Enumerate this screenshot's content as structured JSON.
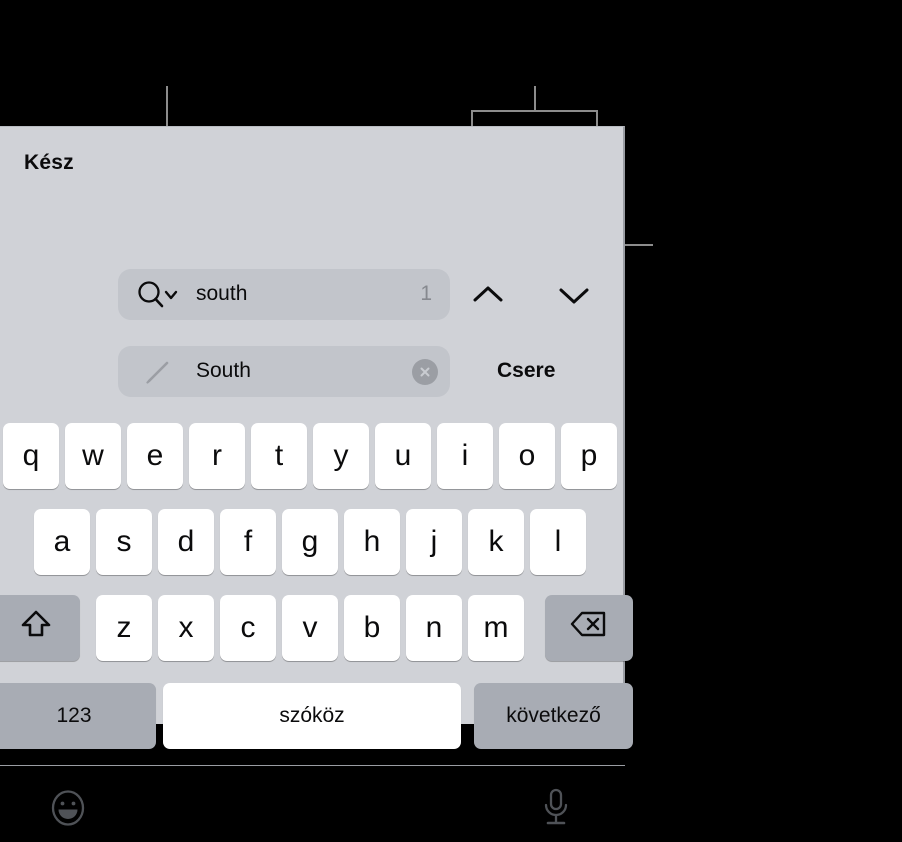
{
  "background_color": "#000000",
  "panel": {
    "background_color": "#d0d2d7",
    "key_color": "#ffffff",
    "special_key_color": "#a8acb4",
    "field_color": "#c2c5cb"
  },
  "find_bar": {
    "done_label": "Kész",
    "replace_label": "Csere",
    "find_field": {
      "icon": "search-icon",
      "dropdown_icon": "chevron-down-icon",
      "value": "south",
      "match_count": "1"
    },
    "replace_field": {
      "icon": "pencil-icon",
      "value": "South",
      "clear_icon": "close-circle-icon"
    },
    "nav": {
      "previous_icon": "chevron-up-icon",
      "next_icon": "chevron-down-icon"
    }
  },
  "keyboard": {
    "rows": [
      {
        "name": "row-1",
        "keys": [
          {
            "label": "q",
            "name": "key-q",
            "type": "letter"
          },
          {
            "label": "w",
            "name": "key-w",
            "type": "letter"
          },
          {
            "label": "e",
            "name": "key-e",
            "type": "letter"
          },
          {
            "label": "r",
            "name": "key-r",
            "type": "letter"
          },
          {
            "label": "t",
            "name": "key-t",
            "type": "letter"
          },
          {
            "label": "y",
            "name": "key-y",
            "type": "letter"
          },
          {
            "label": "u",
            "name": "key-u",
            "type": "letter"
          },
          {
            "label": "i",
            "name": "key-i",
            "type": "letter"
          },
          {
            "label": "o",
            "name": "key-o",
            "type": "letter"
          },
          {
            "label": "p",
            "name": "key-p",
            "type": "letter"
          }
        ]
      },
      {
        "name": "row-2",
        "keys": [
          {
            "label": "a",
            "name": "key-a",
            "type": "letter"
          },
          {
            "label": "s",
            "name": "key-s",
            "type": "letter"
          },
          {
            "label": "d",
            "name": "key-d",
            "type": "letter"
          },
          {
            "label": "f",
            "name": "key-f",
            "type": "letter"
          },
          {
            "label": "g",
            "name": "key-g",
            "type": "letter"
          },
          {
            "label": "h",
            "name": "key-h",
            "type": "letter"
          },
          {
            "label": "j",
            "name": "key-j",
            "type": "letter"
          },
          {
            "label": "k",
            "name": "key-k",
            "type": "letter"
          },
          {
            "label": "l",
            "name": "key-l",
            "type": "letter"
          }
        ]
      },
      {
        "name": "row-3",
        "keys": [
          {
            "label": "",
            "name": "key-shift",
            "type": "shift",
            "icon": "shift-arrow-icon"
          },
          {
            "label": "z",
            "name": "key-z",
            "type": "letter"
          },
          {
            "label": "x",
            "name": "key-x",
            "type": "letter"
          },
          {
            "label": "c",
            "name": "key-c",
            "type": "letter"
          },
          {
            "label": "v",
            "name": "key-v",
            "type": "letter"
          },
          {
            "label": "b",
            "name": "key-b",
            "type": "letter"
          },
          {
            "label": "n",
            "name": "key-n",
            "type": "letter"
          },
          {
            "label": "m",
            "name": "key-m",
            "type": "letter"
          },
          {
            "label": "",
            "name": "key-backspace",
            "type": "backspace",
            "icon": "delete-left-icon"
          }
        ]
      },
      {
        "name": "row-4",
        "keys": [
          {
            "label": "123",
            "name": "key-numbers",
            "type": "special"
          },
          {
            "label": "szóköz",
            "name": "key-space",
            "type": "space"
          },
          {
            "label": "következő",
            "name": "key-next",
            "type": "special"
          }
        ]
      }
    ],
    "utility": {
      "emoji_icon": "emoji-smiley-icon",
      "microphone_icon": "microphone-icon"
    }
  },
  "annotations": {
    "leader_color": "#8c8c8c",
    "callouts": [
      {
        "name": "callout-search-field",
        "target": "find-field-search-icon"
      },
      {
        "name": "callout-navigation-arrows",
        "target": "find-navigation-buttons"
      },
      {
        "name": "callout-replace-button",
        "target": "replace-button"
      }
    ]
  }
}
